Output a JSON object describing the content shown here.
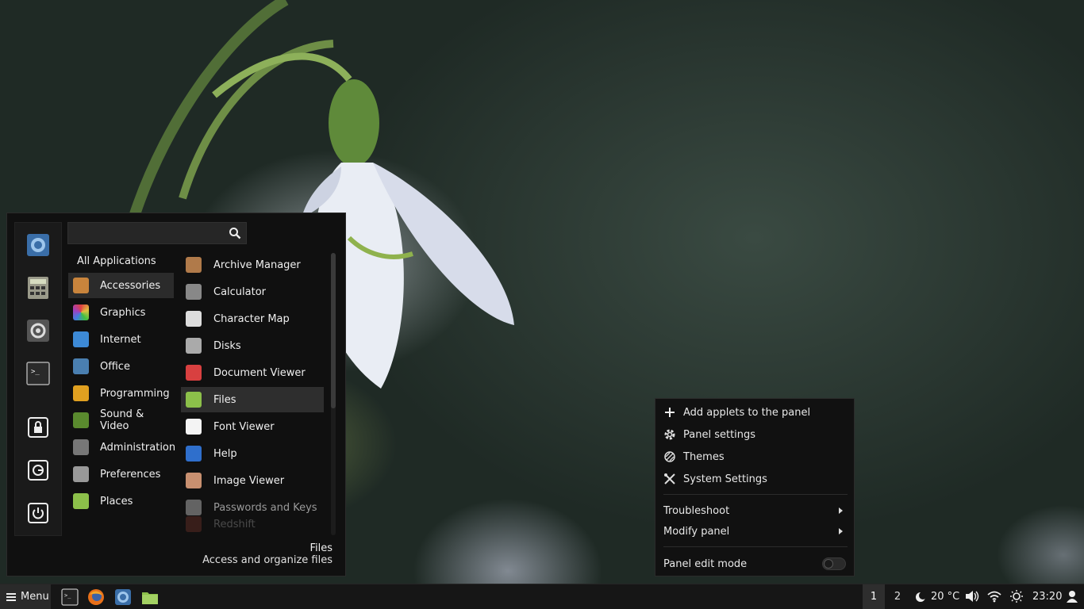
{
  "search": {
    "value": "",
    "placeholder": ""
  },
  "favorites": [
    {
      "name": "chromium-icon",
      "label": "Chromium"
    },
    {
      "name": "calculator-icon",
      "label": "Calculator"
    },
    {
      "name": "system-settings-icon",
      "label": "System Settings"
    },
    {
      "name": "terminal-icon",
      "label": "Terminal"
    },
    {
      "name": "lock-icon",
      "label": "Lock Screen"
    },
    {
      "name": "logout-icon",
      "label": "Log Out"
    },
    {
      "name": "power-icon",
      "label": "Quit"
    }
  ],
  "categories": {
    "all": "All Applications",
    "items": [
      {
        "label": "Accessories",
        "icon": "accessories-icon",
        "color": "#c8843c"
      },
      {
        "label": "Graphics",
        "icon": "graphics-icon",
        "color": "#e0403a"
      },
      {
        "label": "Internet",
        "icon": "internet-icon",
        "color": "#3d8ad6"
      },
      {
        "label": "Office",
        "icon": "office-icon",
        "color": "#4a7fb0"
      },
      {
        "label": "Programming",
        "icon": "programming-icon",
        "color": "#e0a020"
      },
      {
        "label": "Sound & Video",
        "icon": "sound-video-icon",
        "color": "#5a8a2e"
      },
      {
        "label": "Administration",
        "icon": "administration-icon",
        "color": "#777777"
      },
      {
        "label": "Preferences",
        "icon": "preferences-icon",
        "color": "#999999"
      },
      {
        "label": "Places",
        "icon": "places-icon",
        "color": "#8cc04a"
      }
    ]
  },
  "apps": [
    {
      "label": "Archive Manager",
      "icon": "archive-manager-icon",
      "color": "#b07a4a"
    },
    {
      "label": "Calculator",
      "icon": "calculator-icon",
      "color": "#888888"
    },
    {
      "label": "Character Map",
      "icon": "character-map-icon",
      "color": "#dddddd"
    },
    {
      "label": "Disks",
      "icon": "disks-icon",
      "color": "#aaaaaa"
    },
    {
      "label": "Document Viewer",
      "icon": "document-viewer-icon",
      "color": "#d84040"
    },
    {
      "label": "Files",
      "icon": "files-folder-icon",
      "color": "#8cc04a"
    },
    {
      "label": "Font Viewer",
      "icon": "font-viewer-icon",
      "color": "#f4f4f4"
    },
    {
      "label": "Help",
      "icon": "help-icon",
      "color": "#2f6fcc"
    },
    {
      "label": "Image Viewer",
      "icon": "image-viewer-icon",
      "color": "#c89070"
    },
    {
      "label": "Passwords and Keys",
      "icon": "passwords-keys-icon",
      "color": "#888888"
    },
    {
      "label": "Redshift",
      "icon": "redshift-icon",
      "color": "#b04a3a"
    }
  ],
  "description": {
    "title": "Files",
    "text": "Access and organize files"
  },
  "context_menu": {
    "items": [
      {
        "label": "Add applets to the panel",
        "icon": "plus-icon"
      },
      {
        "label": "Panel settings",
        "icon": "gear-icon"
      },
      {
        "label": "Themes",
        "icon": "themes-icon"
      },
      {
        "label": "System Settings",
        "icon": "tools-icon"
      }
    ],
    "submenus": [
      {
        "label": "Troubleshoot"
      },
      {
        "label": "Modify panel"
      }
    ],
    "edit_mode": {
      "label": "Panel edit mode",
      "enabled": false
    }
  },
  "panel": {
    "menu_label": "Menu",
    "launchers": [
      "terminal-icon",
      "firefox-icon",
      "chromium-icon",
      "files-folder-icon"
    ],
    "workspaces": [
      "1",
      "2"
    ],
    "weather": "20 °C",
    "clock": "23:20"
  },
  "colors": {
    "panel_bg": "#161616",
    "menu_bg": "#101010",
    "highlight": "#2e2e2e"
  }
}
